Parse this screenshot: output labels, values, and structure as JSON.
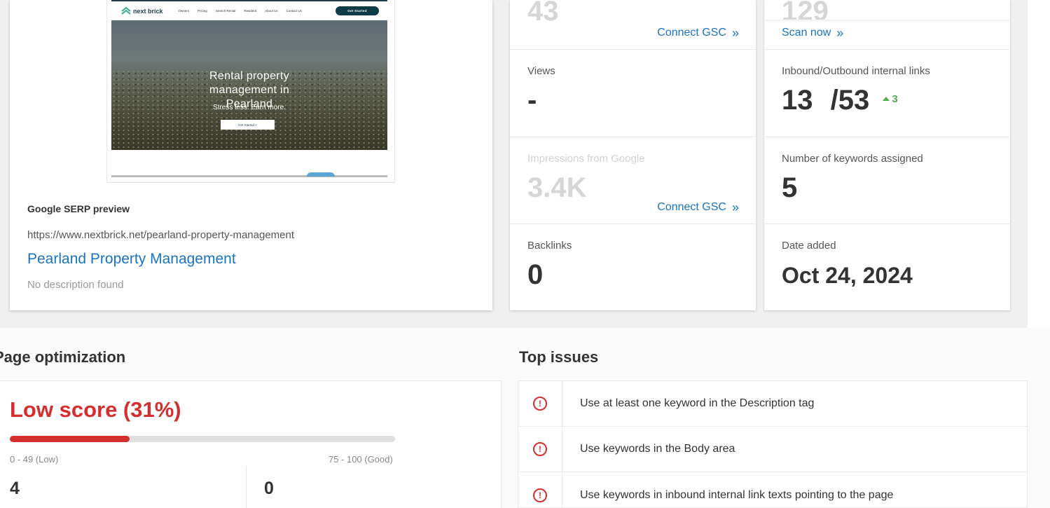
{
  "preview": {
    "site_logo": "next brick",
    "nav": [
      "Owners",
      "Pricing",
      "Search Rental",
      "Resident",
      "About Us",
      "Contact Us"
    ],
    "nav_cta": "Get Started",
    "hero_title": "Rental property management in Pearland",
    "hero_subtitle": "Stress less. Earn more.",
    "hero_button": "Get Started >"
  },
  "serp": {
    "label": "Google SERP preview",
    "url": "https://www.nextbrick.net/pearland-property-management",
    "title": "Pearland Property Management",
    "description": "No description found"
  },
  "metrics_left": {
    "top_value": "43",
    "top_link": "Connect GSC",
    "views_label": "Views",
    "views_value": "-",
    "impressions_label": "Impressions from Google",
    "impressions_value": "3.4K",
    "impressions_link": "Connect GSC",
    "backlinks_label": "Backlinks",
    "backlinks_value": "0"
  },
  "metrics_right": {
    "top_value": "129",
    "top_link": "Scan now",
    "links_label": "Inbound/Outbound internal links",
    "links_inbound": "13",
    "links_outbound": "/53",
    "links_delta": "3",
    "keywords_label": "Number of keywords assigned",
    "keywords_value": "5",
    "date_label": "Date added",
    "date_value": "Oct 24, 2024"
  },
  "optimization": {
    "title": "Page optimization",
    "score_label": "Low score (31%)",
    "score_percent": 31,
    "range_low": "0 - 49 (Low)",
    "range_good": "75 - 100 (Good)",
    "stat_a": "4",
    "stat_b": "0"
  },
  "issues": {
    "title": "Top issues",
    "items": [
      "Use at least one keyword in the Description tag",
      "Use keywords in the Body area",
      "Use keywords in inbound internal link texts pointing to the page"
    ]
  },
  "colors": {
    "link": "#1a73c0",
    "danger": "#d32f2f",
    "positive": "#4caf50"
  }
}
